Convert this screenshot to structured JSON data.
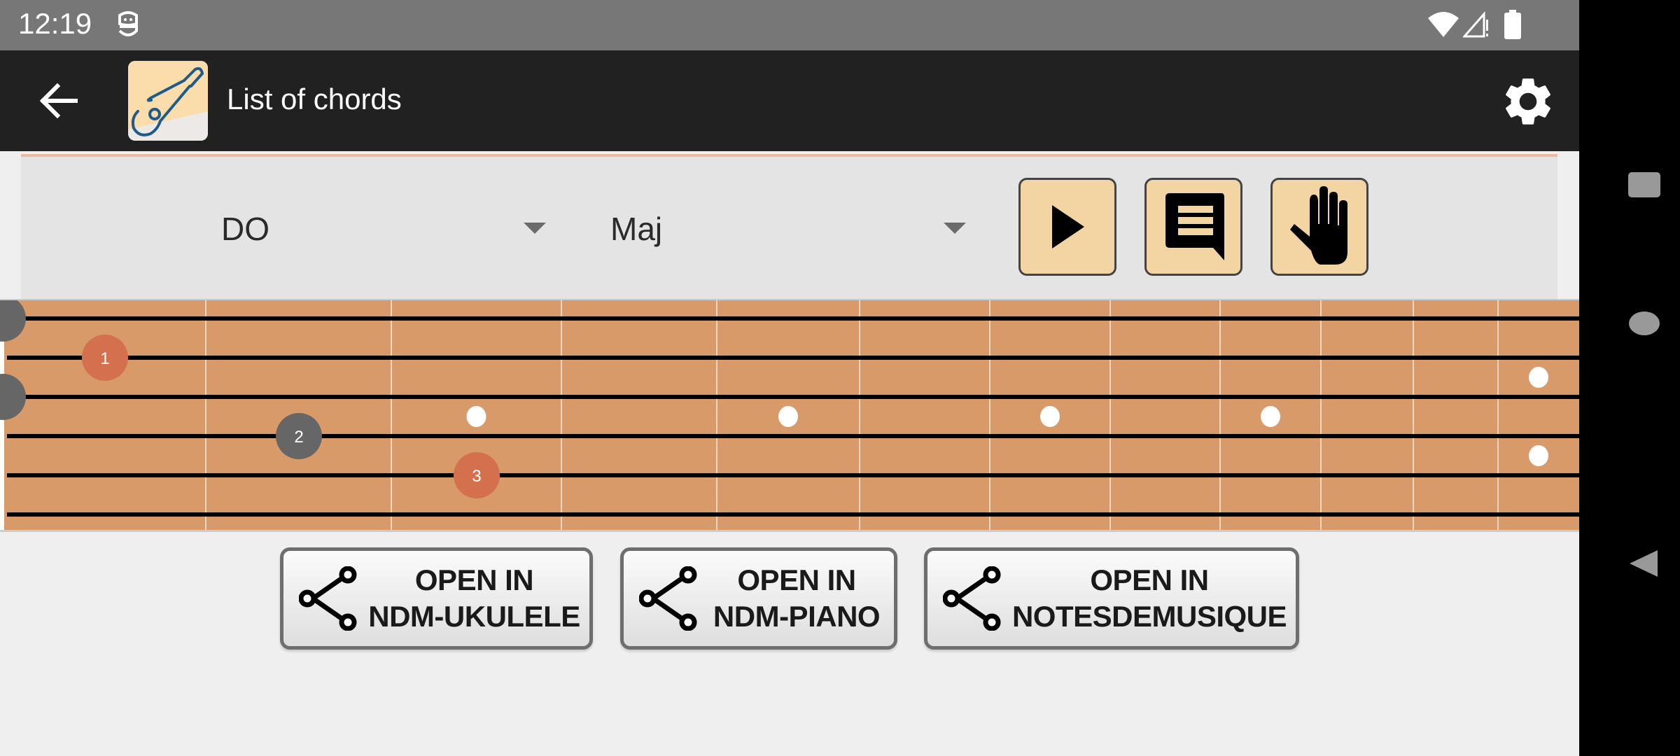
{
  "status_bar": {
    "time": "12:19",
    "icons": [
      "android-debug-icon",
      "wifi-icon",
      "signal-no-service-icon",
      "battery-full-icon"
    ]
  },
  "toolbar": {
    "back_icon": "arrow-back-icon",
    "app_icon": "guitar-app-icon",
    "title": "List of chords",
    "settings_icon": "gear-icon"
  },
  "controls": {
    "root_note": {
      "selected": "DO"
    },
    "chord_type": {
      "selected": "Maj"
    },
    "buttons": [
      {
        "name": "play",
        "icon": "play-icon"
      },
      {
        "name": "notes",
        "icon": "chat-message-icon"
      },
      {
        "name": "fingering",
        "icon": "hand-icon"
      }
    ],
    "button_color": "#f3d5a4"
  },
  "fretboard": {
    "string_count": 6,
    "fret_count": 11,
    "open_strings": [
      1,
      3
    ],
    "fingers": [
      {
        "label": "1",
        "string": 2,
        "fret": 1,
        "color": "#d4704e"
      },
      {
        "label": "2",
        "string": 4,
        "fret": 2,
        "color": "#666666"
      },
      {
        "label": "3",
        "string": 5,
        "fret": 3,
        "color": "#d4704e"
      }
    ],
    "inlays": [
      {
        "fret": 3,
        "between_strings": [
          3,
          4
        ]
      },
      {
        "fret": 5,
        "between_strings": [
          3,
          4
        ]
      },
      {
        "fret": 7,
        "between_strings": [
          3,
          4
        ]
      },
      {
        "fret": 9,
        "between_strings": [
          3,
          4
        ]
      },
      {
        "fret": 12,
        "between_strings": [
          2,
          3
        ]
      },
      {
        "fret": 12,
        "between_strings": [
          4,
          5
        ]
      }
    ],
    "wood_color": "#d99a69"
  },
  "actions": [
    {
      "line1": "OPEN IN",
      "line2": "NDM-UKULELE",
      "icon": "share-icon"
    },
    {
      "line1": "OPEN IN",
      "line2": "NDM-PIANO",
      "icon": "share-icon"
    },
    {
      "line1": "OPEN IN",
      "line2": "NOTESDEMUSIQUE",
      "icon": "share-icon"
    }
  ],
  "nav_bar": {
    "recents_icon": "square-icon",
    "home_icon": "circle-icon",
    "back_icon": "triangle-back-icon"
  }
}
